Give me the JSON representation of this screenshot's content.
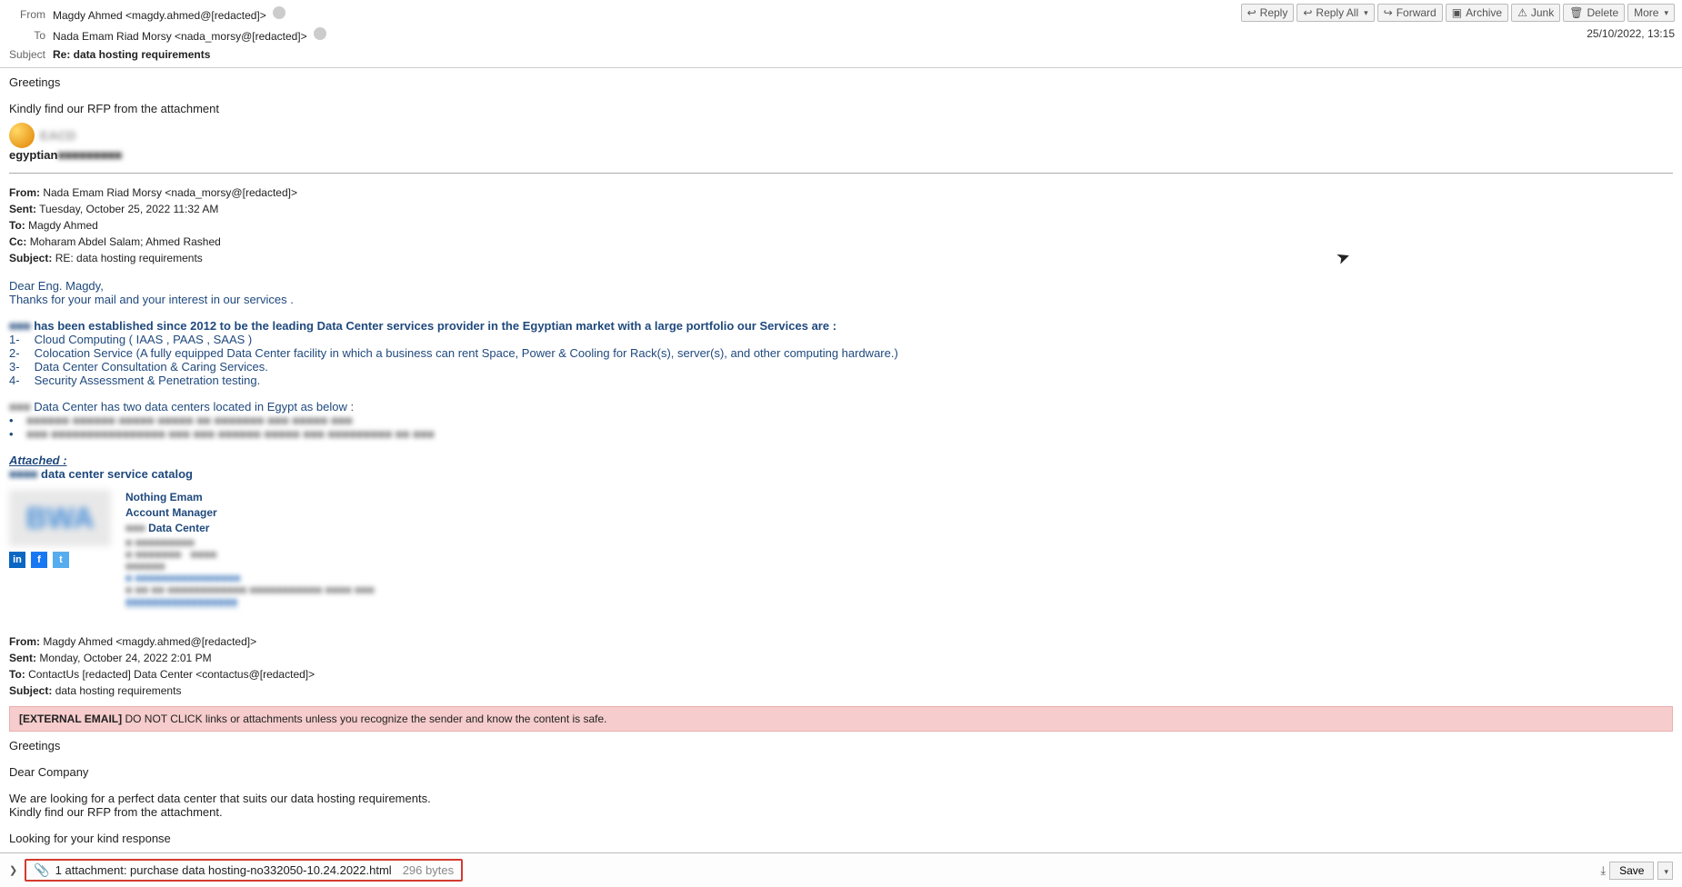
{
  "header": {
    "from_label": "From",
    "from_value": "Magdy Ahmed <magdy.ahmed@[redacted]>",
    "to_label": "To",
    "to_value": "Nada Emam Riad Morsy <nada_morsy@[redacted]>",
    "subject_label": "Subject",
    "subject_value": "Re: data hosting requirements",
    "timestamp": "25/10/2022, 13:15"
  },
  "toolbar": {
    "reply": "Reply",
    "reply_all": "Reply All",
    "forward": "Forward",
    "archive": "Archive",
    "junk": "Junk",
    "delete": "Delete",
    "more": "More"
  },
  "body": {
    "greeting": "Greetings",
    "line1": "Kindly find our RFP from the attachment",
    "egyptian_prefix": "egyptian",
    "quoted1": {
      "from_lbl": "From:",
      "from_val": "Nada Emam Riad Morsy <nada_morsy@[redacted]>",
      "sent_lbl": "Sent:",
      "sent_val": "Tuesday, October 25, 2022 11:32 AM",
      "to_lbl": "To:",
      "to_val": "Magdy Ahmed",
      "cc_lbl": "Cc:",
      "cc_val": "Moharam Abdel Salam; Ahmed Rashed",
      "subj_lbl": "Subject:",
      "subj_val": "RE: data hosting requirements"
    },
    "dear": "Dear Eng. Magdy,",
    "thanks": "Thanks for your mail and your interest in our services .",
    "established": "has been established since 2012 to be the leading Data Center services provider in the Egyptian market with a large portfolio our Services are :",
    "svc1_idx": "1-",
    "svc1": "Cloud Computing ( IAAS , PAAS , SAAS )",
    "svc2_idx": "2-",
    "svc2": "Colocation Service (A fully equipped Data Center facility in which a business can rent Space, Power & Cooling for Rack(s), server(s), and other computing hardware.)",
    "svc3_idx": "3-",
    "svc3": "Data Center Consultation & Caring Services.",
    "svc4_idx": "4-",
    "svc4": "Security Assessment & Penetration testing.",
    "dc_intro": "Data Center has two data centers located in Egypt as below :",
    "attached_lbl": "Attached :",
    "catalog": "data center service catalog",
    "sig_name": "Nothing Emam",
    "sig_title": "Account Manager",
    "sig_dc": "Data Center",
    "quoted2": {
      "from_lbl": "From:",
      "from_val": "Magdy Ahmed <magdy.ahmed@[redacted]>",
      "sent_lbl": "Sent:",
      "sent_val": "Monday, October 24, 2022 2:01 PM",
      "to_lbl": "To:",
      "to_val": "ContactUs [redacted] Data Center <contactus@[redacted]>",
      "subj_lbl": "Subject:",
      "subj_val": "data hosting requirements"
    },
    "ext_label": "[EXTERNAL EMAIL]",
    "ext_text": "DO NOT CLICK links or attachments unless you recognize the sender and know the content is safe.",
    "orig_greet": "Greetings",
    "orig_dear": "Dear Company",
    "orig_l1": "We are looking for a perfect data center that suits our data hosting requirements.",
    "orig_l2": "Kindly find our RFP from the attachment.",
    "orig_l3": "Looking for your kind response"
  },
  "attachment": {
    "summary": "1 attachment: purchase data hosting-no332050-10.24.2022.html",
    "size": "296 bytes",
    "save": "Save"
  }
}
